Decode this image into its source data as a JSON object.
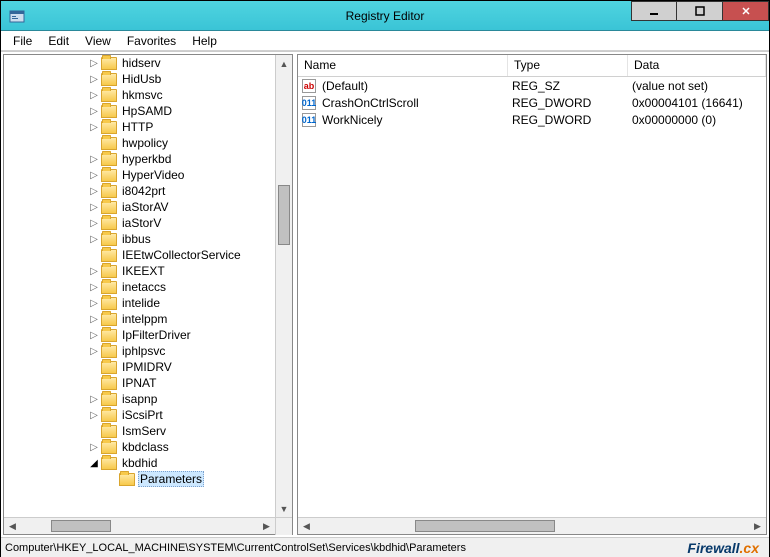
{
  "window": {
    "title": "Registry Editor"
  },
  "menu": {
    "file": "File",
    "edit": "Edit",
    "view": "View",
    "favorites": "Favorites",
    "help": "Help"
  },
  "tree": [
    {
      "label": "hidserv",
      "exp": "closed"
    },
    {
      "label": "HidUsb",
      "exp": "closed"
    },
    {
      "label": "hkmsvc",
      "exp": "closed"
    },
    {
      "label": "HpSAMD",
      "exp": "closed"
    },
    {
      "label": "HTTP",
      "exp": "closed"
    },
    {
      "label": "hwpolicy",
      "exp": "none"
    },
    {
      "label": "hyperkbd",
      "exp": "closed"
    },
    {
      "label": "HyperVideo",
      "exp": "closed"
    },
    {
      "label": "i8042prt",
      "exp": "closed"
    },
    {
      "label": "iaStorAV",
      "exp": "closed"
    },
    {
      "label": "iaStorV",
      "exp": "closed"
    },
    {
      "label": "ibbus",
      "exp": "closed"
    },
    {
      "label": "IEEtwCollectorService",
      "exp": "none"
    },
    {
      "label": "IKEEXT",
      "exp": "closed"
    },
    {
      "label": "inetaccs",
      "exp": "closed"
    },
    {
      "label": "intelide",
      "exp": "closed"
    },
    {
      "label": "intelppm",
      "exp": "closed"
    },
    {
      "label": "IpFilterDriver",
      "exp": "closed"
    },
    {
      "label": "iphlpsvc",
      "exp": "closed"
    },
    {
      "label": "IPMIDRV",
      "exp": "none"
    },
    {
      "label": "IPNAT",
      "exp": "none"
    },
    {
      "label": "isapnp",
      "exp": "closed"
    },
    {
      "label": "iScsiPrt",
      "exp": "closed"
    },
    {
      "label": "IsmServ",
      "exp": "none"
    },
    {
      "label": "kbdclass",
      "exp": "closed"
    },
    {
      "label": "kbdhid",
      "exp": "open",
      "children": [
        {
          "label": "Parameters",
          "selected": true
        }
      ]
    }
  ],
  "columns": {
    "name": "Name",
    "type": "Type",
    "data": "Data"
  },
  "values": [
    {
      "icon": "string",
      "name": "(Default)",
      "type": "REG_SZ",
      "data": "(value not set)"
    },
    {
      "icon": "dword",
      "name": "CrashOnCtrlScroll",
      "type": "REG_DWORD",
      "data": "0x00004101 (16641)"
    },
    {
      "icon": "dword",
      "name": "WorkNicely",
      "type": "REG_DWORD",
      "data": "0x00000000 (0)"
    }
  ],
  "status": {
    "path": "Computer\\HKEY_LOCAL_MACHINE\\SYSTEM\\CurrentControlSet\\Services\\kbdhid\\Parameters"
  },
  "watermark": {
    "p1": "Firewall",
    "p2": ".cx"
  }
}
